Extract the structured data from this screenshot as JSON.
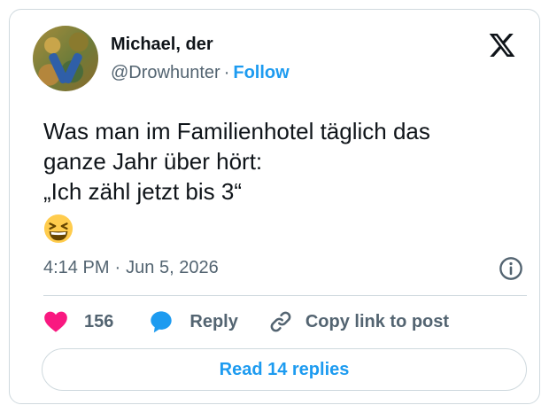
{
  "author": {
    "name": "Michael, der",
    "handle": "@Drowhunter",
    "separator": "·",
    "follow_label": "Follow"
  },
  "tweet": {
    "lines": [
      "Was man im Familienhotel täglich das",
      "ganze Jahr über hört:",
      "„Ich zähl jetzt bis 3“"
    ],
    "emoji": "grinning-squinting-face"
  },
  "meta": {
    "time": "4:14 PM",
    "separator": "·",
    "date": "Jun 5, 2026"
  },
  "actions": {
    "like_count": "156",
    "reply_label": "Reply",
    "copy_link_label": "Copy link to post"
  },
  "read_replies_label": "Read 14 replies",
  "colors": {
    "accent": "#1d9bf0",
    "like": "#f91880",
    "text": "#0f1419",
    "muted": "#536471",
    "border": "#cfd9de"
  },
  "icons": [
    "x-logo-icon",
    "info-icon",
    "heart-icon",
    "reply-bubble-icon",
    "link-icon"
  ]
}
